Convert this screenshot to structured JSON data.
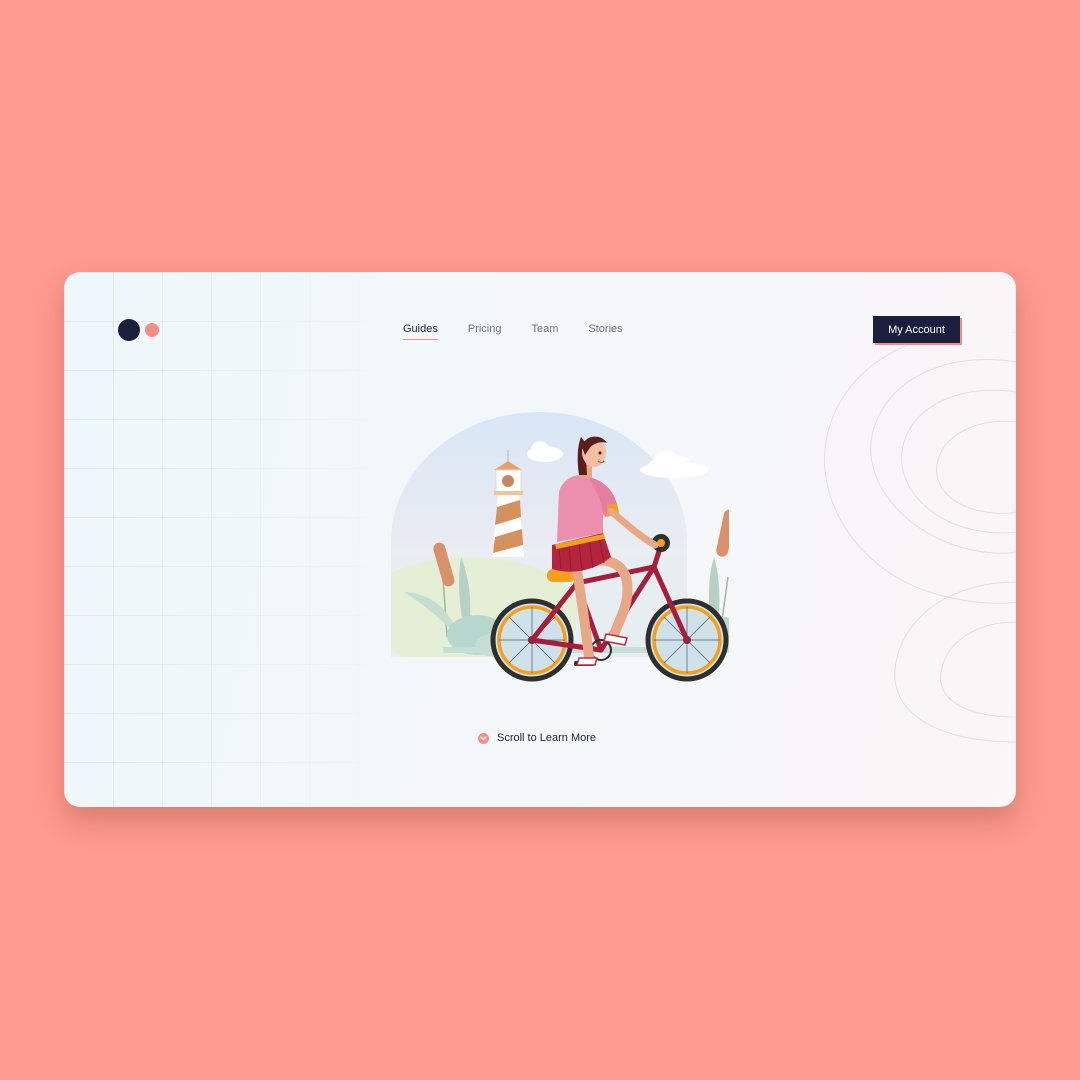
{
  "nav": {
    "items": [
      {
        "label": "Guides",
        "active": true
      },
      {
        "label": "Pricing",
        "active": false
      },
      {
        "label": "Team",
        "active": false
      },
      {
        "label": "Stories",
        "active": false
      }
    ]
  },
  "header": {
    "account_label": "My Account"
  },
  "hero": {
    "scroll_label": "Scroll to Learn More"
  },
  "icons": {
    "logo": "two-dot-logo",
    "scroll": "chevron-down-icon"
  },
  "colors": {
    "background": "#FF9A8E",
    "navy": "#1B1F3E",
    "coral": "#F38E84"
  }
}
